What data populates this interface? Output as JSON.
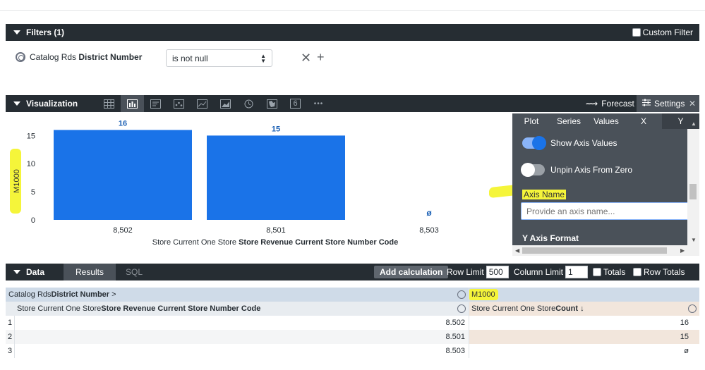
{
  "filters": {
    "title": "Filters (1)",
    "custom_filter_label": "Custom Filter",
    "field_prefix": "Catalog Rds ",
    "field_name": "District Number",
    "operator": "is not null"
  },
  "visualization": {
    "title": "Visualization",
    "chart_icons": [
      "table-icon",
      "bar-chart-icon",
      "list-icon",
      "scatter-icon",
      "line-chart-icon",
      "area-chart-icon",
      "clock-icon",
      "map-icon",
      "single-value-icon",
      "more-icon"
    ],
    "single_value_glyph": "6",
    "more_glyph": "•••",
    "forecast_label": "Forecast",
    "settings_label": "Settings"
  },
  "chart_data": {
    "type": "bar",
    "categories": [
      "8,502",
      "8,501",
      "8,503"
    ],
    "values": [
      16,
      15,
      null
    ],
    "data_labels": [
      "16",
      "15",
      "ø"
    ],
    "xlabel_prefix": "Store Current One Store ",
    "xlabel_bold": "Store Revenue Current Store Number Code",
    "ylabel": "M1000",
    "yticks": [
      "0",
      "5",
      "10",
      "15"
    ],
    "ylim": [
      0,
      16.8
    ],
    "bar_color": "#1a73e8",
    "grid": false
  },
  "settings_panel": {
    "tabs": [
      "Plot",
      "Series",
      "Values",
      "X",
      "Y"
    ],
    "active_tab": "Y",
    "show_axis_values_label": "Show Axis Values",
    "show_axis_values_on": true,
    "unpin_axis_label": "Unpin Axis From Zero",
    "unpin_axis_on": false,
    "axis_name_label": "Axis Name",
    "axis_name_placeholder": "Provide an axis name...",
    "y_axis_format_label": "Y Axis Format",
    "accent_color": "#1a73e8"
  },
  "data": {
    "title": "Data",
    "results_tab": "Results",
    "sql_tab": "SQL",
    "add_calculation": "Add calculation",
    "row_limit_label": "Row Limit",
    "row_limit_value": "500",
    "column_limit_label": "Column Limit",
    "column_limit_value": "1",
    "totals_label": "Totals",
    "row_totals_label": "Row Totals",
    "pivot_prefix": "Catalog Rds ",
    "pivot_name": "District Number",
    "pivot_arrow": ">",
    "pivot_value": "M1000",
    "dim_prefix": "Store Current One Store ",
    "dim_name": "Store Revenue Current Store Number Code",
    "measure_prefix": "Store Current One Store ",
    "measure_name": "Count",
    "sort_arrow": "↓",
    "rows": [
      {
        "n": "1",
        "code": "8.502",
        "count": "16"
      },
      {
        "n": "2",
        "code": "8.501",
        "count": "15"
      },
      {
        "n": "3",
        "code": "8.503",
        "count": "ø"
      }
    ]
  }
}
